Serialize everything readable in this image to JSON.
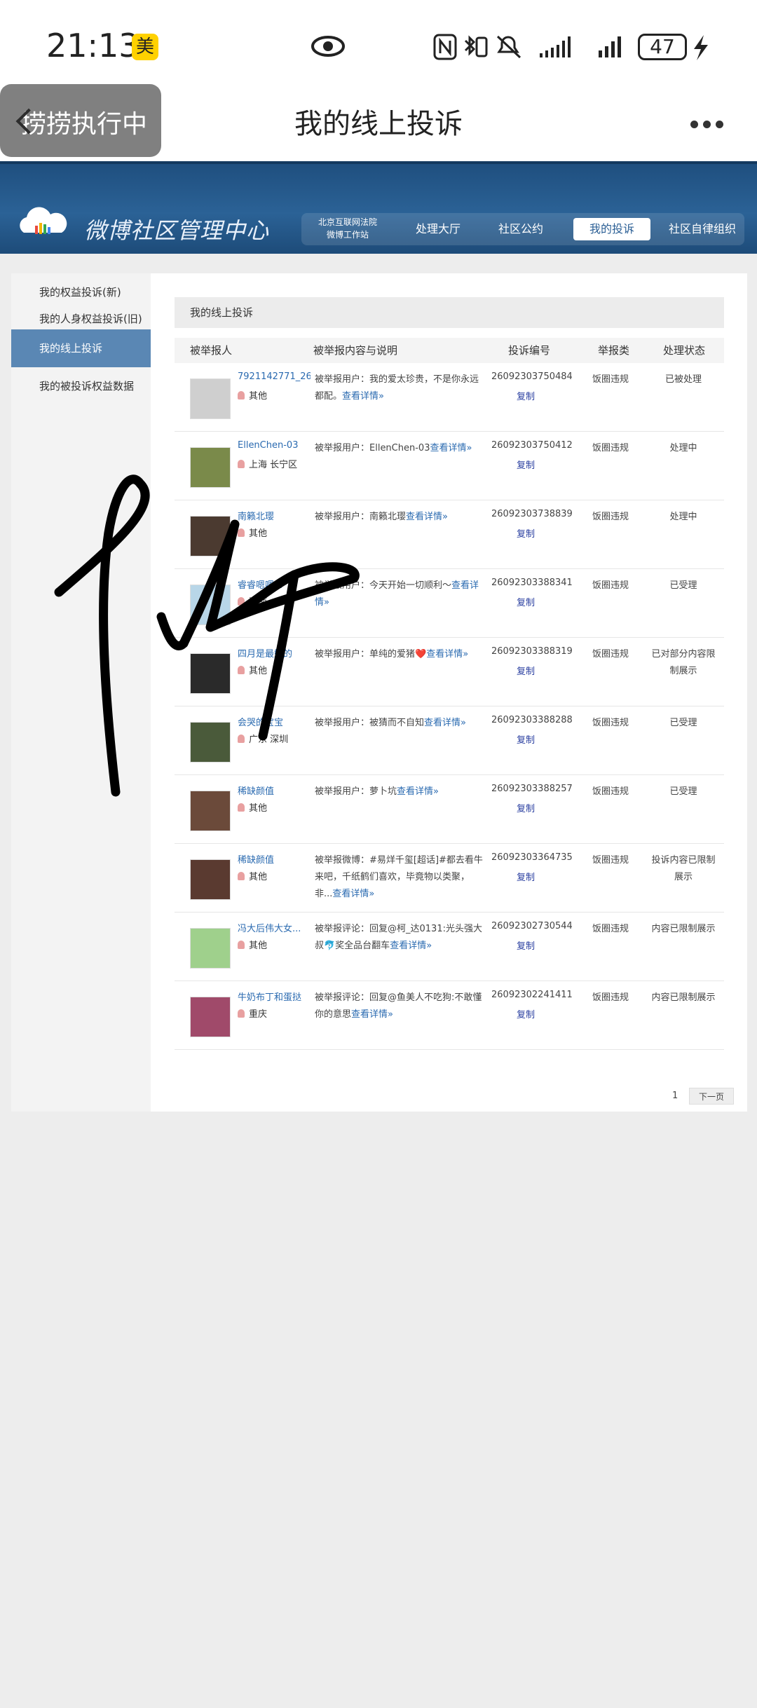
{
  "status_bar": {
    "time": "21:13",
    "app_badge": "美",
    "battery": "47",
    "icons": [
      "eye-icon",
      "nfc-icon",
      "bluetooth-icon",
      "mute-icon",
      "signal-icon",
      "signal-icon-2",
      "charging-icon"
    ]
  },
  "titlebar": {
    "back_overlay_text": "捞捞执行中",
    "title": "我的线上投诉",
    "more_icon": "more-dots-icon"
  },
  "weibo_header": {
    "brand": "微博社区管理中心",
    "court_line1": "北京互联网法院",
    "court_line2": "微博工作站",
    "nav": [
      "处理大厅",
      "社区公约",
      "我的投诉",
      "社区自律组织"
    ],
    "active_nav": "我的投诉"
  },
  "sidebar": {
    "items": [
      "我的权益投诉(新)",
      "我的人身权益投诉(旧)",
      "我的线上投诉",
      "我的被投诉权益数据"
    ],
    "active": "我的线上投诉"
  },
  "main": {
    "section_title": "我的线上投诉",
    "columns": [
      "被举报人",
      "被举报内容与说明",
      "投诉编号",
      "举报类",
      "处理状态"
    ],
    "copy_label": "复制",
    "rows": [
      {
        "user": "7921142771_263",
        "loc": "其他",
        "desc": "被举报用户：我的爱太珍贵，不是你永远都配。",
        "link": "查看详情»",
        "id": "26092303750484",
        "cat": "饭圈违规",
        "status": "已被处理"
      },
      {
        "user": "EllenChen-03",
        "loc": "上海 长宁区",
        "desc": "被举报用户：EllenChen-03",
        "link": "查看详情»",
        "id": "26092303750412",
        "cat": "饭圈违规",
        "status": "处理中"
      },
      {
        "user": "南籁北璎",
        "loc": "其他",
        "desc": "被举报用户：南籁北璎",
        "link": "查看详情»",
        "id": "26092303738839",
        "cat": "饭圈违规",
        "status": "处理中"
      },
      {
        "user": "睿睿嗯嗯ni",
        "loc": "河南",
        "desc": "被举报用户：今天开始一切顺利～",
        "link": "查看详情»",
        "id": "26092303388341",
        "cat": "饭圈违规",
        "status": "已受理"
      },
      {
        "user": "四月是最好的",
        "loc": "其他",
        "desc": "被举报用户：单纯的爱猪❤️",
        "link": "查看详情»",
        "id": "26092303388319",
        "cat": "饭圈违规",
        "status": "已对部分内容限制展示"
      },
      {
        "user": "会哭的宝宝",
        "loc": "广东 深圳",
        "desc": "被举报用户：被猜而不自知",
        "link": "查看详情»",
        "id": "26092303388288",
        "cat": "饭圈违规",
        "status": "已受理"
      },
      {
        "user": "稀缺颜值",
        "loc": "其他",
        "desc": "被举报用户：萝卜坑",
        "link": "查看详情»",
        "id": "26092303388257",
        "cat": "饭圈违规",
        "status": "已受理"
      },
      {
        "user": "稀缺颜值",
        "loc": "其他",
        "desc": "被举报微博：#易烊千玺[超话]#都去看牛来吧，千纸鹤们喜欢，毕竟物以类聚，非...",
        "link": "查看详情»",
        "id": "26092303364735",
        "cat": "饭圈违规",
        "status": "投诉内容已限制展示"
      },
      {
        "user": "冯大后伟大女...",
        "loc": "其他",
        "desc": "被举报评论：回复@柯_达0131:光头强大叔🐬奖全品台翻车",
        "link": "查看详情»",
        "id": "26092302730544",
        "cat": "饭圈违规",
        "status": "内容已限制展示"
      },
      {
        "user": "牛奶布丁和蛋挞",
        "loc": "重庆",
        "desc": "被举报评论：回复@鱼美人不吃狗:不敢懂你的意思",
        "link": "查看详情»",
        "id": "26092302241411",
        "cat": "饭圈违规",
        "status": "内容已限制展示"
      }
    ]
  },
  "pager": {
    "page": "1",
    "next": "下一页"
  },
  "colors": {
    "header_blue": "#2b6296",
    "sidebar_active": "#5a87b4",
    "link": "#2a6ab0",
    "ink": "#000000"
  }
}
